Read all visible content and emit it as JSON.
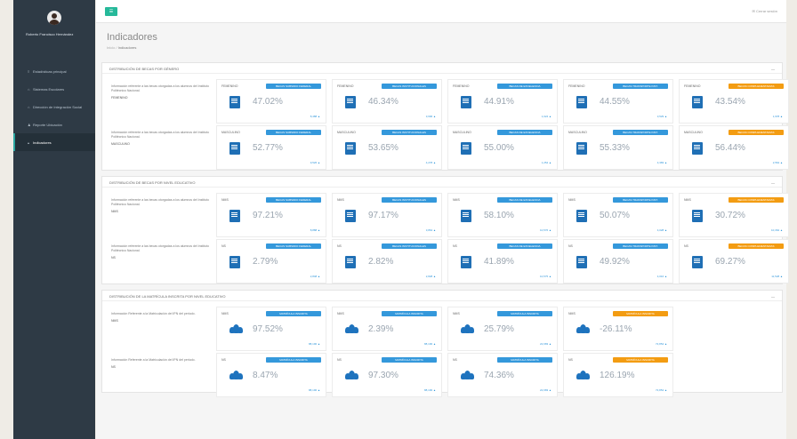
{
  "app": {
    "user_name": "Roberto Francisco Hernández",
    "user_menu": "✉ Cerrar sesión"
  },
  "sidebar": {
    "items": [
      {
        "label": "Estadísticas principal",
        "icon": "bars-icon",
        "active": false
      },
      {
        "label": "Sistemas Escolares",
        "icon": "home-icon",
        "active": false
      },
      {
        "label": "Dirección de Integración Social",
        "icon": "home-icon",
        "active": false
      },
      {
        "label": "Reporte Ubicación",
        "icon": "users-icon",
        "active": false
      },
      {
        "label": "Indicadores",
        "icon": "chart-icon",
        "active": true
      }
    ]
  },
  "header": {
    "title": "Indicadores",
    "breadcrumb_home": "Inicio",
    "breadcrumb_sep": " / ",
    "breadcrumb_current": "Indicadores"
  },
  "sections": [
    {
      "title": "DISTRIBUCIÓN DE BECAS POR GÉNERO",
      "rows": [
        {
          "info": "Información referente a las becas otorgadas a los alumnos del Instituto Politécnico Nacional.",
          "sub": "FEMENINO",
          "cards": [
            {
              "label": "FEMENINO",
              "badge": "BECAS SUBSIDIO FEDERAL",
              "value": "47.02%",
              "foot": "8,488 ▲",
              "orange": false
            },
            {
              "label": "FEMENINO",
              "badge": "BECAS INSTITUCIONALES",
              "value": "46.34%",
              "foot": "3,696 ▲",
              "orange": false
            },
            {
              "label": "FEMENINO",
              "badge": "BECAS DE EXCELENCIA",
              "value": "44.91%",
              "foot": "1,024 ▲",
              "orange": false
            },
            {
              "label": "FEMENINO",
              "badge": "BECAS TRANSPORTE INST.",
              "value": "44.55%",
              "foot": "3,529 ▲",
              "orange": false
            },
            {
              "label": "FEMENINO",
              "badge": "BECAS COMPLEMENTARIAS",
              "value": "43.54%",
              "foot": "1,978 ▲",
              "orange": true
            }
          ]
        },
        {
          "info": "Información referente a las becas otorgadas a los alumnos del Instituto Politécnico Nacional.",
          "sub": "MASCULINO",
          "cards": [
            {
              "label": "MASCULINO",
              "badge": "BECAS SUBSIDIO FEDERAL",
              "value": "52.77%",
              "foot": "9,526 ▲",
              "orange": false
            },
            {
              "label": "MASCULINO",
              "badge": "BECAS INSTITUCIONALES",
              "value": "53.65%",
              "foot": "4,278 ▲",
              "orange": false
            },
            {
              "label": "MASCULINO",
              "badge": "BECAS DE EXCELENCIA",
              "value": "55.00%",
              "foot": "1,254 ▲",
              "orange": false
            },
            {
              "label": "MASCULINO",
              "badge": "BECAS TRANSPORTE INST.",
              "value": "55.33%",
              "foot": "4,383 ▲",
              "orange": false
            },
            {
              "label": "MASCULINO",
              "badge": "BECAS COMPLEMENTARIAS",
              "value": "56.44%",
              "foot": "2,564 ▲",
              "orange": true
            }
          ]
        }
      ]
    },
    {
      "title": "DISTRIBUCIÓN DE BECAS POR NIVEL EDUCATIVO",
      "rows": [
        {
          "info": "Información referente a las becas otorgadas a los alumnos del Instituto Politécnico Nacional.",
          "sub": "NMS",
          "cards": [
            {
              "label": "NMS",
              "badge": "BECAS SUBSIDIO FEDERAL",
              "value": "97.21%",
              "foot": "8,888 ▲",
              "orange": false
            },
            {
              "label": "NMS",
              "badge": "BECAS INSTITUCIONALES",
              "value": "97.17%",
              "foot": "3,864 ▲",
              "orange": false
            },
            {
              "label": "NMS",
              "badge": "BECAS DE EXCELENCIA",
              "value": "58.10%",
              "foot": "10,576 ▲",
              "orange": false
            },
            {
              "label": "NMS",
              "badge": "BECAS TRANSPORTE INST.",
              "value": "50.07%",
              "foot": "4,028 ▲",
              "orange": false
            },
            {
              "label": "NMS",
              "badge": "BECAS COMPLEMENTARIAS",
              "value": "30.72%",
              "foot": "10,362 ▲",
              "orange": true
            }
          ]
        },
        {
          "info": "Información referente a las becas otorgadas a los alumnos del Instituto Politécnico Nacional.",
          "sub": "NS",
          "cards": [
            {
              "label": "NS",
              "badge": "BECAS SUBSIDIO FEDERAL",
              "value": "2.79%",
              "foot": "2,848 ▲",
              "orange": false
            },
            {
              "label": "NS",
              "badge": "BECAS INSTITUCIONALES",
              "value": "2.82%",
              "foot": "2,828 ▲",
              "orange": false
            },
            {
              "label": "NS",
              "badge": "BECAS DE EXCELENCIA",
              "value": "41.89%",
              "foot": "10,575 ▲",
              "orange": false
            },
            {
              "label": "NS",
              "badge": "BECAS TRANSPORTE INST.",
              "value": "49.92%",
              "foot": "4,016 ▲",
              "orange": false
            },
            {
              "label": "NS",
              "badge": "BECAS COMPLEMENTARIAS",
              "value": "69.27%",
              "foot": "11,528 ▲",
              "orange": true
            }
          ]
        }
      ]
    },
    {
      "title": "DISTRIBUCIÓN DE LA MATRÍCULA INSCRITA POR NIVEL EDUCATIVO",
      "rows": [
        {
          "info": "Información Referente a la Matriculación del IPN del periodo.",
          "sub": "NMS",
          "cards": [
            {
              "label": "NMS",
              "badge": "MATRÍCULA INSCRITA",
              "value": "97.52%",
              "foot": "88,190 ▲",
              "orange": false
            },
            {
              "label": "NMS",
              "badge": "MATRÍCULA INSCRITA",
              "value": "2.39%",
              "foot": "88,190 ▲",
              "orange": false
            },
            {
              "label": "NMS",
              "badge": "MATRÍCULA INSCRITA",
              "value": "25.79%",
              "foot": "22,683 ▲",
              "orange": false
            },
            {
              "label": "NMS",
              "badge": "MATRÍCULA INSCRITA",
              "value": "-26.11%",
              "foot": "72,854 ▲",
              "orange": true
            }
          ]
        },
        {
          "info": "Información Referente a la Matriculación del IPN del periodo.",
          "sub": "NS",
          "cards": [
            {
              "label": "NS",
              "badge": "MATRÍCULA INSCRITA",
              "value": "8.47%",
              "foot": "88,190 ▲",
              "orange": false
            },
            {
              "label": "NS",
              "badge": "MATRÍCULA INSCRITA",
              "value": "97.30%",
              "foot": "88,190 ▲",
              "orange": false
            },
            {
              "label": "NS",
              "badge": "MATRÍCULA INSCRITA",
              "value": "74.36%",
              "foot": "22,683 ▲",
              "orange": false
            },
            {
              "label": "NS",
              "badge": "MATRÍCULA INSCRITA",
              "value": "126.19%",
              "foot": "72,854 ▲",
              "orange": true
            }
          ]
        }
      ]
    }
  ],
  "colors": {
    "sidebar": "#2e3a45",
    "accent": "#26b99a",
    "badge_blue": "#3498db",
    "badge_orange": "#f39c12",
    "icon_blue": "#1e73be"
  }
}
